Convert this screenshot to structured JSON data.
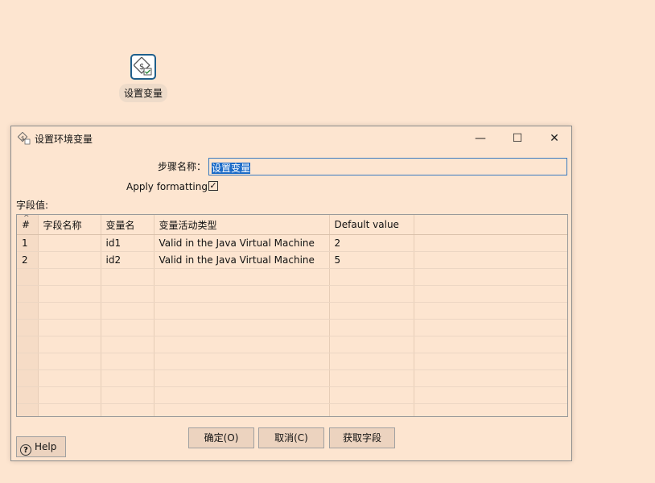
{
  "canvas": {
    "step_label": "设置变量"
  },
  "dialog": {
    "title": "设置环境变量",
    "window_controls": {
      "minimize": "—",
      "maximize": "☐",
      "close": "✕"
    },
    "step_name_label": "步骤名称：",
    "step_name_value": "设置变量",
    "apply_formatting_label": "Apply formatting",
    "apply_formatting_checked": "✓",
    "fields_label": "字段值:",
    "table": {
      "columns": [
        "#",
        "字段名称",
        "变量名",
        "变量活动类型",
        "Default value",
        ""
      ],
      "rows": [
        [
          "1",
          "",
          "id1",
          "Valid in the Java Virtual Machine",
          "2",
          ""
        ],
        [
          "2",
          "",
          "id2",
          "Valid in the Java Virtual Machine",
          "5",
          ""
        ],
        [
          "",
          "",
          "",
          "",
          "",
          ""
        ],
        [
          "",
          "",
          "",
          "",
          "",
          ""
        ],
        [
          "",
          "",
          "",
          "",
          "",
          ""
        ],
        [
          "",
          "",
          "",
          "",
          "",
          ""
        ],
        [
          "",
          "",
          "",
          "",
          "",
          ""
        ],
        [
          "",
          "",
          "",
          "",
          "",
          ""
        ],
        [
          "",
          "",
          "",
          "",
          "",
          ""
        ],
        [
          "",
          "",
          "",
          "",
          "",
          ""
        ],
        [
          "",
          "",
          "",
          "",
          "",
          ""
        ]
      ]
    },
    "buttons": {
      "ok": "确定(O)",
      "cancel": "取消(C)",
      "get_fields": "获取字段",
      "help": "Help"
    }
  },
  "colors": {
    "background": "#fde5d0",
    "selection": "#1c6bc7",
    "icon_border": "#1f5f8b"
  }
}
